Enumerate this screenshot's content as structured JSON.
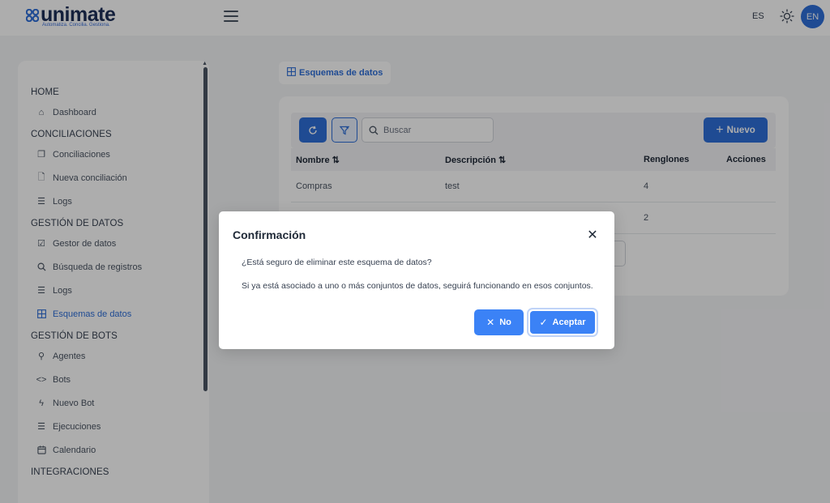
{
  "header": {
    "logo_text": "unimate",
    "logo_tagline": "Automatiza. Concilia. Gestiona.",
    "lang_es": "ES",
    "lang_en": "EN",
    "brand_color": "#1d2f57",
    "accent_color": "#2f6fd9"
  },
  "sidebar": {
    "sections": [
      {
        "title": "HOME",
        "items": [
          {
            "label": "Dashboard",
            "icon": "home-icon"
          }
        ]
      },
      {
        "title": "CONCILIACIONES",
        "items": [
          {
            "label": "Conciliaciones",
            "icon": "copy-icon"
          },
          {
            "label": "Nueva conciliación",
            "icon": "file-icon"
          },
          {
            "label": "Logs",
            "icon": "list-icon"
          }
        ]
      },
      {
        "title": "GESTIÓN DE DATOS",
        "items": [
          {
            "label": "Gestor de datos",
            "icon": "check-square-icon"
          },
          {
            "label": "Búsqueda de registros",
            "icon": "search-icon"
          },
          {
            "label": "Logs",
            "icon": "list-icon"
          },
          {
            "label": "Esquemas de datos",
            "icon": "table-icon",
            "active": true
          }
        ]
      },
      {
        "title": "GESTIÓN DE BOTS",
        "items": [
          {
            "label": "Agentes",
            "icon": "key-icon"
          },
          {
            "label": "Bots",
            "icon": "code-icon"
          },
          {
            "label": "Nuevo Bot",
            "icon": "bolt-icon"
          },
          {
            "label": "Ejecuciones",
            "icon": "list-icon"
          },
          {
            "label": "Calendario",
            "icon": "calendar-icon"
          }
        ]
      },
      {
        "title": "INTEGRACIONES",
        "items": []
      }
    ]
  },
  "breadcrumb": {
    "label": "Esquemas de datos"
  },
  "toolbar": {
    "search_placeholder": "Buscar",
    "new_label": "Nuevo"
  },
  "table": {
    "columns": [
      "Nombre",
      "Descripción",
      "Renglones",
      "Acciones"
    ],
    "rows": [
      {
        "nombre": "Compras",
        "descripcion": "test",
        "renglones": "4"
      },
      {
        "nombre": "",
        "descripcion": "",
        "renglones": "2"
      }
    ]
  },
  "dialog": {
    "title": "Confirmación",
    "message1": "¿Está seguro de eliminar este esquema de datos?",
    "message2": "Si ya está asociado a uno o más conjuntos de datos, seguirá funcionando en esos conjuntos.",
    "no_label": "No",
    "accept_label": "Aceptar"
  }
}
